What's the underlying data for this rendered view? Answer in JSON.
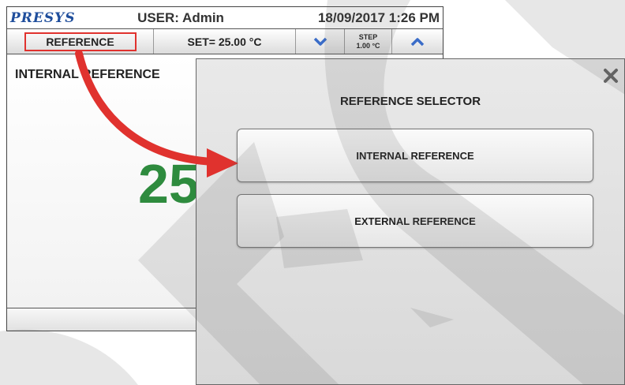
{
  "header": {
    "brand": "PRESYS",
    "user": "USER: Admin",
    "datetime": "18/09/2017  1:26 PM"
  },
  "controls": {
    "reference_label": "REFERENCE",
    "set_label": "SET= 25.00 °C",
    "step_title": "STEP",
    "step_value": "1.00 °C"
  },
  "main": {
    "reference_mode": "INTERNAL REFERENCE",
    "value": "25"
  },
  "dialog": {
    "title": "REFERENCE SELECTOR",
    "options": [
      {
        "label": "INTERNAL REFERENCE"
      },
      {
        "label": "EXTERNAL REFERENCE"
      }
    ]
  },
  "colors": {
    "brand": "#1f4e9c",
    "value": "#2e8b3e",
    "highlight": "#e0322e",
    "arrow_button": "#3a6cc8"
  },
  "icons": {
    "close": "close-icon",
    "down": "chevron-down-icon",
    "up": "chevron-up-icon"
  }
}
